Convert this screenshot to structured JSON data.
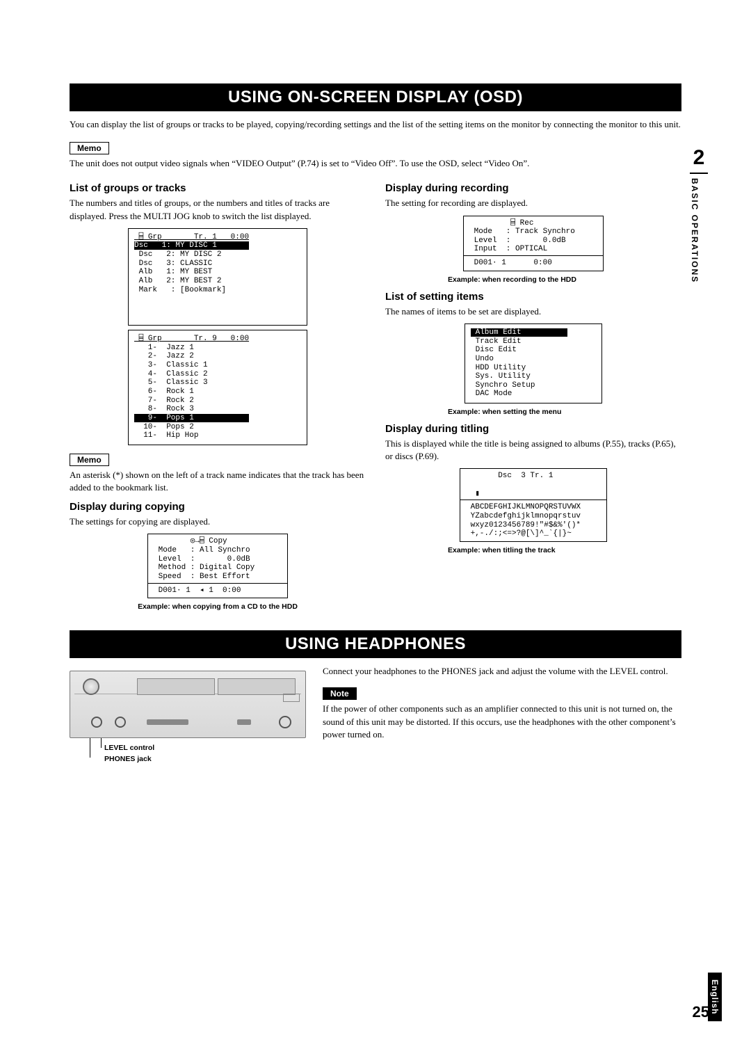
{
  "section1_title": "USING ON-SCREEN DISPLAY (OSD)",
  "section1_intro": "You can display the list of groups or tracks to be played, copying/recording settings and the list of the setting items on the monitor by connecting the monitor to this unit.",
  "memo_label": "Memo",
  "note_label": "Note",
  "memo1_text": "The unit does not output video signals when “VIDEO Output” (P.74) is set to “Video Off”. To use the OSD, select “Video On”.",
  "col_left": {
    "sub1": "List of groups or tracks",
    "body1": "The numbers and titles of groups, or the numbers and titles of tracks are displayed. Press the MULTI JOG knob to switch the list displayed.",
    "osd_groups_header": " ⌸ Grp       Tr. 1   0:00",
    "osd_groups_sel": "Dsc   1: MY DISC 1       ",
    "osd_groups_lines": " Dsc   2: MY DISC 2\n Dsc   3: CLASSIC\n Alb   1: MY BEST\n Alb   2: MY BEST 2\n Mark   : [Bookmark]",
    "osd_tracks_header": " ⌸ Grp       Tr. 9   0:00",
    "osd_tracks_lines_a": "   1-  Jazz 1\n   2-  Jazz 2\n   3-  Classic 1\n   4-  Classic 2\n   5-  Classic 3\n   6-  Rock 1\n   7-  Rock 2\n   8-  Rock 3",
    "osd_tracks_sel": "   9-  Pops 1            ",
    "osd_tracks_lines_b": "  10-  Pops 2\n  11-  Hip Hop",
    "memo2_text": "An asterisk (*) shown on the left of a track name indicates that the track has been added to the bookmark list.",
    "sub2": "Display during copying",
    "body2": "The settings for copying are displayed.",
    "osd_copy_top": "        ◎→⌸ Copy\n Mode   : All Synchro\n Level  :       0.0dB\n Method : Digital Copy\n Speed  : Best Effort",
    "osd_copy_bottom": " D001· 1  ◂ 1  0:00",
    "caption_copy": "Example: when copying from a CD to the HDD"
  },
  "col_right": {
    "sub1": "Display during recording",
    "body1": "The setting for recording are displayed.",
    "osd_rec_top": "         ⌸ Rec\n Mode   : Track Synchro\n Level  :       0.0dB\n Input  : OPTICAL",
    "osd_rec_bottom": " D001· 1      0:00",
    "caption_rec": "Example: when recording to the HDD",
    "sub2": "List of setting items",
    "body2": "The names of items to be set are displayed.",
    "osd_menu_sel": " Album Edit          ",
    "osd_menu_lines": " Track Edit\n Disc Edit\n Undo\n HDD Utility\n Sys. Utility\n Synchro Setup\n DAC Mode",
    "caption_menu": "Example: when setting the menu",
    "sub3": "Display during titling",
    "body3": "This is displayed while the title is being assigned to albums (P.55), tracks (P.65), or discs (P.69).",
    "osd_title_top": "       Dsc  3 Tr. 1\n\n  ▮",
    "osd_title_sel": "A",
    "osd_title_chars": "BCDEFGHIJKLMNOPQRSTUVWX\n YZabcdefghijklmnopqrstuv\n wxyz0123456789!\"#$&%'()*\n +,-./:;<=>?@[\\]^_`{|}~",
    "caption_title": "Example: when titling the track"
  },
  "section2_title": "USING HEADPHONES",
  "hp_body1": "Connect your headphones to the PHONES jack and adjust the volume with the LEVEL control.",
  "hp_note": "If the power of other components such as an amplifier connected to this unit is not turned on, the sound of this unit may be distorted. If this occurs, use the headphones with the other component’s power turned on.",
  "callout_level": "LEVEL control",
  "callout_phones": "PHONES jack",
  "sidebar": {
    "num": "2",
    "label": "BASIC OPERATIONS"
  },
  "page_number": "25",
  "language_tab": "English"
}
